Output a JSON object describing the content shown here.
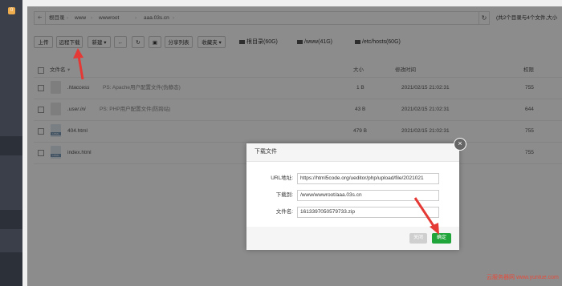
{
  "sidebar": {
    "badge": "0"
  },
  "breadcrumb": [
    "根目录",
    "www",
    "wwwroot",
    "aaa.03s.cn"
  ],
  "summary": "(共2个目录与4个文件,大小",
  "toolbar": {
    "upload": "上传",
    "remote_download": "远程下载",
    "new": "新建",
    "share_list": "分享列表",
    "favorites": "收藏夹"
  },
  "disks": [
    "根目录(60G)",
    "/www(41G)",
    "/etc/hosts(60G)"
  ],
  "table": {
    "headers": {
      "name": "文件名",
      "size": "大小",
      "mtime": "修改时间",
      "perm": "权限"
    },
    "rows": [
      {
        "name": ".htaccess",
        "note": "PS: Apache用户配置文件(伪静态)",
        "size": "1 B",
        "mtime": "2021/02/15 21:02:31",
        "perm": "755",
        "icon": "file-icon"
      },
      {
        "name": ".user.ini",
        "note": "PS: PHP用户配置文件(防跨站)",
        "size": "43 B",
        "mtime": "2021/02/15 21:02:31",
        "perm": "644",
        "icon": "file-icon"
      },
      {
        "name": "404.html",
        "note": "",
        "size": "479 B",
        "mtime": "2021/02/15 21:02:31",
        "perm": "755",
        "icon": "html-file-icon"
      },
      {
        "name": "index.html",
        "note": "",
        "size": "",
        "mtime": "",
        "perm": "755",
        "icon": "html-file-icon"
      }
    ]
  },
  "modal": {
    "title": "下载文件",
    "url_label": "URL地址:",
    "url_value": "https://html5code.org/ueditor/php/upload/file/2021021",
    "dest_label": "下载到:",
    "dest_value": "/www/wwwroot/aaa.03s.cn",
    "filename_label": "文件名:",
    "filename_value": "1613397050579733.zip",
    "close_label": "关闭",
    "ok_label": "确定"
  },
  "watermark": "云服务器网 www.yuntue.com",
  "colors": {
    "accent_green": "#20a53a",
    "arrow_red": "#e53935",
    "sidebar": "#3a3f4a"
  }
}
